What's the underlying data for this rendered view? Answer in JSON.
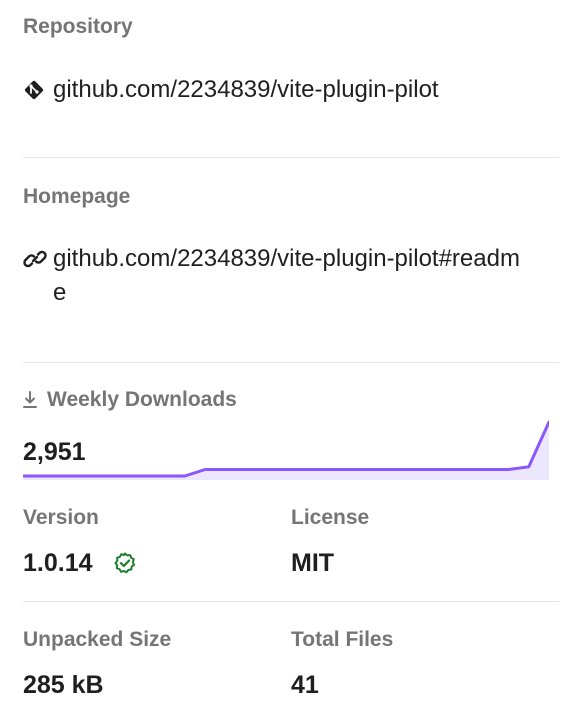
{
  "repository": {
    "label": "Repository",
    "url_text": "github.com/2234839/vite-plugin-pilot",
    "icon": "git-icon"
  },
  "homepage": {
    "label": "Homepage",
    "url_text": "github.com/2234839/vite-plugin-pilot#readme",
    "icon": "link-icon"
  },
  "weekly_downloads": {
    "label": "Weekly Downloads",
    "value": "2,951",
    "icon": "download-icon",
    "sparkline_color": "#8956ff",
    "sparkline_fill": "#ece6ff",
    "sparkline_points": [
      0,
      0,
      0,
      0,
      0,
      0,
      0,
      0,
      0,
      0.12,
      0.12,
      0.12,
      0.12,
      0.12,
      0.12,
      0.12,
      0.12,
      0.12,
      0.12,
      0.12,
      0.12,
      0.12,
      0.12,
      0.12,
      0.12,
      0.17,
      1.0
    ]
  },
  "version": {
    "label": "Version",
    "value": "1.0.14",
    "verified_icon": "verified-check-icon",
    "verified_color": "#1e7f2f"
  },
  "license": {
    "label": "License",
    "value": "MIT"
  },
  "unpacked_size": {
    "label": "Unpacked Size",
    "value": "285 kB"
  },
  "total_files": {
    "label": "Total Files",
    "value": "41"
  }
}
